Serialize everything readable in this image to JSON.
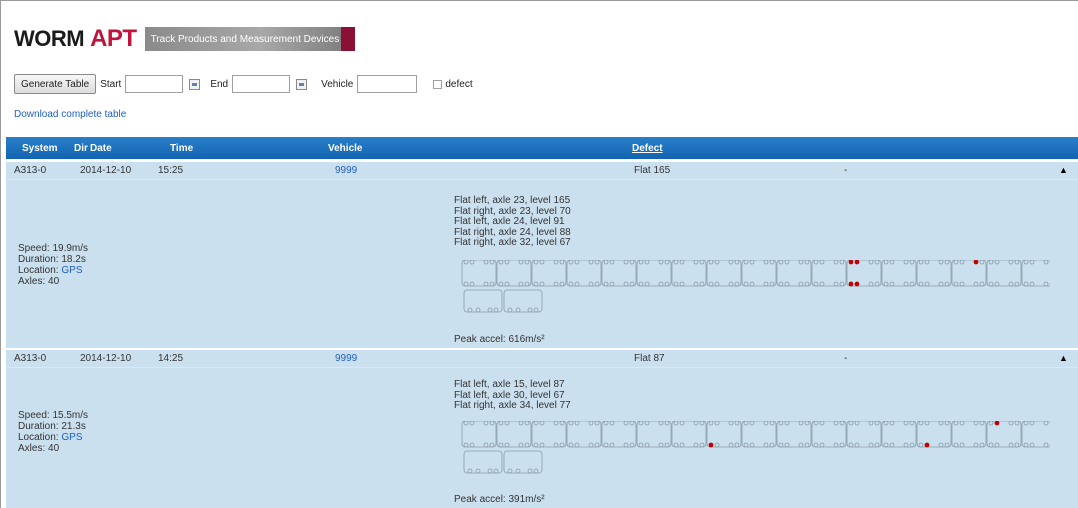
{
  "header": {
    "logo_worm": "WORM",
    "logo_apt": "APT",
    "tagline": "Track Products and Measurement Devices"
  },
  "toolbar": {
    "generate_label": "Generate Table",
    "start_label": "Start",
    "end_label": "End",
    "vehicle_label": "Vehicle",
    "defect_label": "defect",
    "start_value": "",
    "end_value": "",
    "vehicle_value": ""
  },
  "download_link": "Download complete table",
  "table": {
    "columns": {
      "system": "System",
      "dir": "Dir",
      "date": "Date",
      "time": "Time",
      "vehicle": "Vehicle",
      "defect": "Defect"
    },
    "rows": [
      {
        "system": "A313-0",
        "date": "2014-12-10",
        "time": "15:25",
        "vehicle": "9999",
        "defect": "Flat 165",
        "extra": "-",
        "speed": "Speed: 19.9m/s",
        "duration": "Duration: 18.2s",
        "location_label": "Location:",
        "location_link": "GPS",
        "axles": "Axles: 40",
        "defects": [
          "Flat left, axle 23, level 165",
          "Flat right, axle 23, level 70",
          "Flat left, axle 24, level 91",
          "Flat right, axle 24, level 88",
          "Flat right, axle 32, level 67"
        ],
        "peak": "Peak accel: 616m/s²"
      },
      {
        "system": "A313-0",
        "date": "2014-12-10",
        "time": "14:25",
        "vehicle": "9999",
        "defect": "Flat 87",
        "extra": "-",
        "speed": "Speed: 15.5m/s",
        "duration": "Duration: 21.3s",
        "location_label": "Location:",
        "location_link": "GPS",
        "axles": "Axles: 40",
        "defects": [
          "Flat left, axle 15, level 87",
          "Flat left, axle 30, level 67",
          "Flat right, axle 34, level 77"
        ],
        "peak": "Peak accel: 391m/s²"
      }
    ]
  },
  "icons": {
    "calendar": "calendar-icon",
    "expand": "triangle-up-icon"
  },
  "colors": {
    "header_blue": "#1264b0",
    "row_bg": "#cbe0ef",
    "link": "#1f5fc2",
    "flat_marker": "#c00000",
    "apt_red": "#c0143c"
  }
}
